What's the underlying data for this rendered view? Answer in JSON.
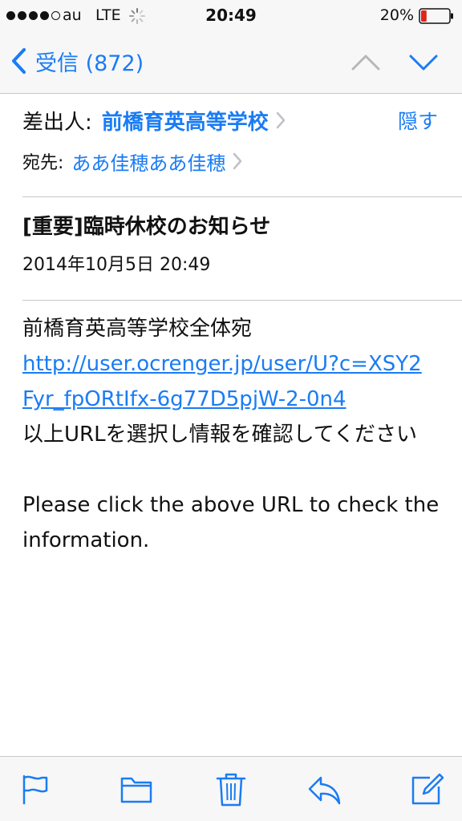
{
  "status_bar": {
    "carrier": "au",
    "network": "LTE",
    "time": "20:49",
    "battery_percent": "20%",
    "battery_level": 0.2,
    "icons": [
      "signal-dots-icon",
      "activity-spinner-icon",
      "battery-icon"
    ]
  },
  "nav": {
    "back_label": "受信 (872)",
    "icons": [
      "chevron-left-icon",
      "chevron-up-icon",
      "chevron-down-icon"
    ]
  },
  "header": {
    "from_label": "差出人:",
    "from_name": "前橋育英高等学校",
    "hide_label": "隠す",
    "to_label": "宛先:",
    "to_name": "ああ佳穂ああ佳穂"
  },
  "message": {
    "subject": "[重要]臨時休校のお知らせ",
    "date": "2014年10月5日 20:49",
    "body_line1": "前橋育英高等学校全体宛",
    "link": "http://user.ocrenger.jp/user/U?c=XSY2Fyr_fpORtIfx-6g77D5pjW-2-0n4",
    "body_jp": "以上URLを選択し情報を確認してください",
    "body_en": "Please click  the above URL to check the information."
  },
  "toolbar": {
    "icons": [
      "flag-icon",
      "folder-icon",
      "trash-icon",
      "reply-icon",
      "compose-icon"
    ]
  },
  "colors": {
    "accent": "#1a7cf4",
    "bar_background": "#f7f7f7",
    "separator": "#c8c7cc",
    "battery_low": "#e0251b"
  }
}
